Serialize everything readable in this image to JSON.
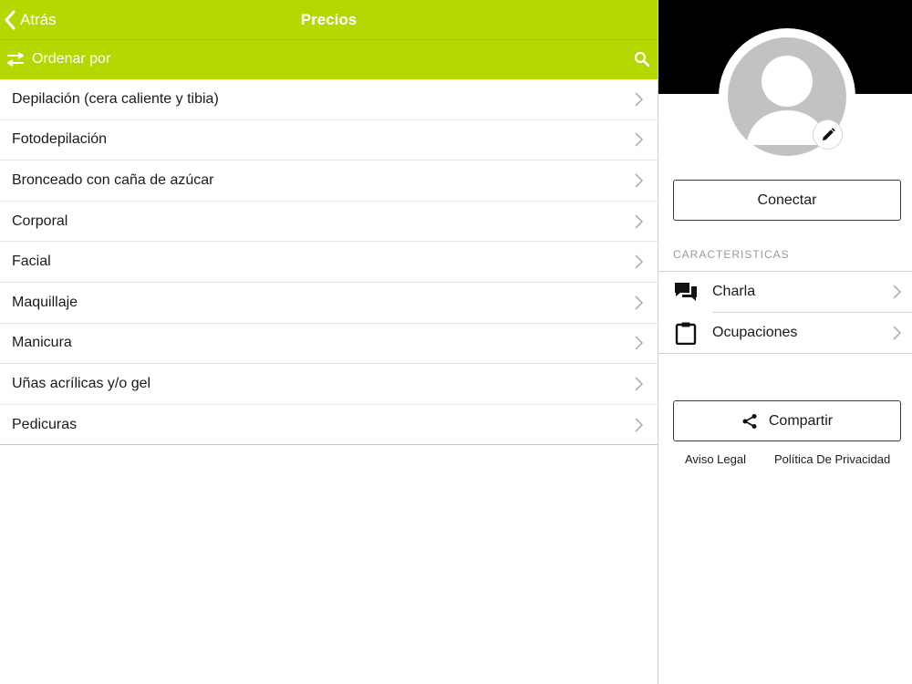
{
  "header": {
    "back_label": "Atrás",
    "title": "Precios",
    "sort_label": "Ordenar por",
    "accent_color": "#b5d800"
  },
  "categories": [
    {
      "label": "Depilación (cera caliente y tibia)"
    },
    {
      "label": "Fotodepilación"
    },
    {
      "label": "Bronceado con caña de azúcar"
    },
    {
      "label": "Corporal"
    },
    {
      "label": "Facial"
    },
    {
      "label": "Maquillaje"
    },
    {
      "label": "Manicura"
    },
    {
      "label": "Uñas acrílicas y/o gel"
    },
    {
      "label": "Pedicuras"
    }
  ],
  "profile": {
    "connect_label": "Conectar",
    "section_title": "CARACTERISTICAS",
    "features": [
      {
        "label": "Charla",
        "icon": "chat-icon"
      },
      {
        "label": "Ocupaciones",
        "icon": "clipboard-icon"
      }
    ],
    "share_label": "Compartir",
    "legal_label": "Aviso Legal",
    "privacy_label": "Política De Privacidad"
  }
}
